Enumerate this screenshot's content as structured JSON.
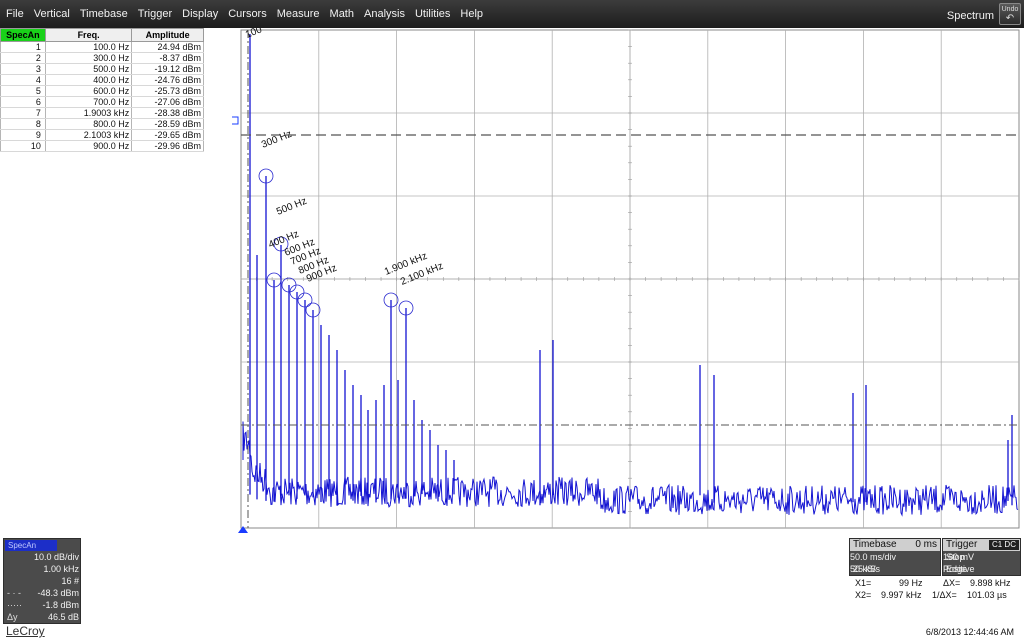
{
  "menu": [
    "File",
    "Vertical",
    "Timebase",
    "Trigger",
    "Display",
    "Cursors",
    "Measure",
    "Math",
    "Analysis",
    "Utilities",
    "Help"
  ],
  "app_title": "Spectrum",
  "undo_label": "Undo",
  "table": {
    "headers": [
      "SpecAn",
      "Freq.",
      "Amplitude"
    ],
    "rows": [
      [
        "1",
        "100.0 Hz",
        "24.94 dBm"
      ],
      [
        "2",
        "300.0 Hz",
        "-8.37 dBm"
      ],
      [
        "3",
        "500.0 Hz",
        "-19.12 dBm"
      ],
      [
        "4",
        "400.0 Hz",
        "-24.76 dBm"
      ],
      [
        "5",
        "600.0 Hz",
        "-25.73 dBm"
      ],
      [
        "6",
        "700.0 Hz",
        "-27.06 dBm"
      ],
      [
        "7",
        "1.9003 kHz",
        "-28.38 dBm"
      ],
      [
        "8",
        "800.0 Hz",
        "-28.59 dBm"
      ],
      [
        "9",
        "2.1003 kHz",
        "-29.65 dBm"
      ],
      [
        "10",
        "900.0 Hz",
        "-29.96 dBm"
      ]
    ]
  },
  "peak_labels": [
    "100",
    "300 Hz",
    "500 Hz",
    "400 Hz",
    "600 Hz",
    "700 Hz",
    "800 Hz",
    "900 Hz",
    "1.900 kHz",
    "2.100 kHz"
  ],
  "trace_descriptor": {
    "label": "SpecAn",
    "lines": [
      {
        "l": "",
        "v": "10.0 dB/div"
      },
      {
        "l": "",
        "v": "1.00 kHz"
      },
      {
        "l": "",
        "v": "16 #"
      },
      {
        "l": "- · -",
        "v": "-48.3 dBm"
      },
      {
        "l": "·····",
        "v": "-1.8 dBm"
      },
      {
        "l": "Δy",
        "v": "46.5 dB"
      }
    ]
  },
  "brand": "LeCroy",
  "timebase": {
    "title": "Timebase",
    "delay": "0 ms",
    "scale": "50.0 ms/div",
    "samples": "25 kS",
    "rate": "50 kS/s"
  },
  "trigger": {
    "title": "Trigger",
    "chip": "C1 DC",
    "mode": "Stop",
    "level": "160 mV",
    "type": "Edge",
    "slope": "Positive"
  },
  "cursors": {
    "x1_label": "X1=",
    "x1": "99 Hz",
    "dx_label": "ΔX=",
    "dx": "9.898 kHz",
    "x2_label": "X2=",
    "x2": "9.997 kHz",
    "inv_label": "1/ΔX=",
    "inv": "101.03 µs"
  },
  "timestamp": "6/8/2013 12:44:46 AM",
  "colors": {
    "trace": "#1414d2",
    "grid": "#9a9a9a",
    "menu_bg": "#262626",
    "spec_header": "#19d219"
  }
}
